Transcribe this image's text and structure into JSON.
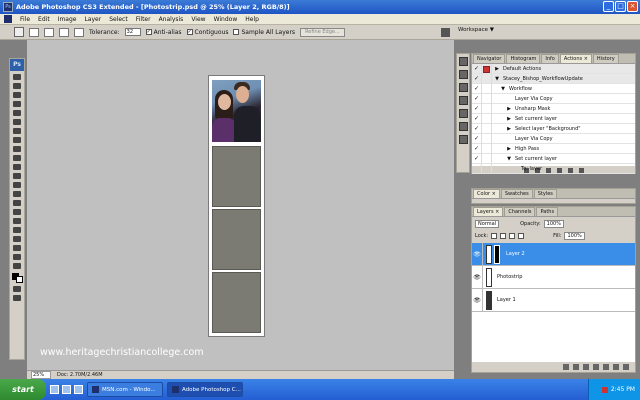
{
  "window": {
    "title": "Adobe Photoshop CS3 Extended - [Photostrip.psd @ 25% (Layer 2, RGB/8)]"
  },
  "menu": [
    "File",
    "Edit",
    "Image",
    "Layer",
    "Select",
    "Filter",
    "Analysis",
    "View",
    "Window",
    "Help"
  ],
  "options": {
    "tolerance_label": "Tolerance:",
    "tolerance_value": "32",
    "anti_alias": "Anti-alias",
    "contiguous": "Contiguous",
    "sample_all": "Sample All Layers",
    "refine_edge": "Refine Edge...",
    "workspace": "Workspace ▼"
  },
  "canvas": {
    "watermark": "www.heritagechristiancollege.com"
  },
  "status": {
    "zoom": "25%",
    "doc": "Doc: 2.70M/2.46M"
  },
  "actions_panel": {
    "tabs": [
      "Navigator",
      "Histogram",
      "Info",
      "Actions ×",
      "History"
    ],
    "rows": [
      {
        "check": "✓",
        "red": true,
        "tri": "▶",
        "indent": 0,
        "label": "Default Actions",
        "header": true
      },
      {
        "check": "✓",
        "red": false,
        "tri": "▼",
        "indent": 0,
        "label": "Stacey_Bishop_WorkflowUpdate",
        "header": true
      },
      {
        "check": "✓",
        "red": false,
        "tri": "▼",
        "indent": 1,
        "label": "Workflow",
        "header": false
      },
      {
        "check": "✓",
        "red": false,
        "tri": "",
        "indent": 2,
        "label": "Layer Via Copy",
        "header": false
      },
      {
        "check": "✓",
        "red": false,
        "tri": "▶",
        "indent": 2,
        "label": "Unsharp Mask",
        "header": false
      },
      {
        "check": "✓",
        "red": false,
        "tri": "▶",
        "indent": 2,
        "label": "Set current layer",
        "header": false
      },
      {
        "check": "✓",
        "red": false,
        "tri": "▶",
        "indent": 2,
        "label": "Select layer \"Background\"",
        "header": false
      },
      {
        "check": "✓",
        "red": false,
        "tri": "",
        "indent": 2,
        "label": "Layer Via Copy",
        "header": false
      },
      {
        "check": "✓",
        "red": false,
        "tri": "▶",
        "indent": 2,
        "label": "High Pass",
        "header": false
      },
      {
        "check": "✓",
        "red": false,
        "tri": "▼",
        "indent": 2,
        "label": "Set current layer",
        "header": false
      },
      {
        "check": "",
        "red": false,
        "tri": "",
        "indent": 3,
        "label": "To: layer",
        "header": false
      }
    ]
  },
  "color_panel": {
    "tabs": [
      "Color ×",
      "Swatches",
      "Styles"
    ]
  },
  "layers_panel": {
    "tabs": [
      "Layers ×",
      "Channels",
      "Paths"
    ],
    "blend_mode": "Normal",
    "opacity_label": "Opacity:",
    "opacity_value": "100%",
    "lock_label": "Lock:",
    "fill_label": "Fill:",
    "fill_value": "100%",
    "layers": [
      {
        "name": "Layer 2",
        "active": true,
        "thumb": "light",
        "mask": true
      },
      {
        "name": "Photostrip",
        "active": false,
        "thumb": "light",
        "mask": false
      },
      {
        "name": "Layer 1",
        "active": false,
        "thumb": "dark",
        "mask": false
      }
    ]
  },
  "taskbar": {
    "start": "start",
    "tasks": [
      "MSN.com - Windo...",
      "Adobe Photoshop C..."
    ],
    "clock": "2:45 PM"
  }
}
